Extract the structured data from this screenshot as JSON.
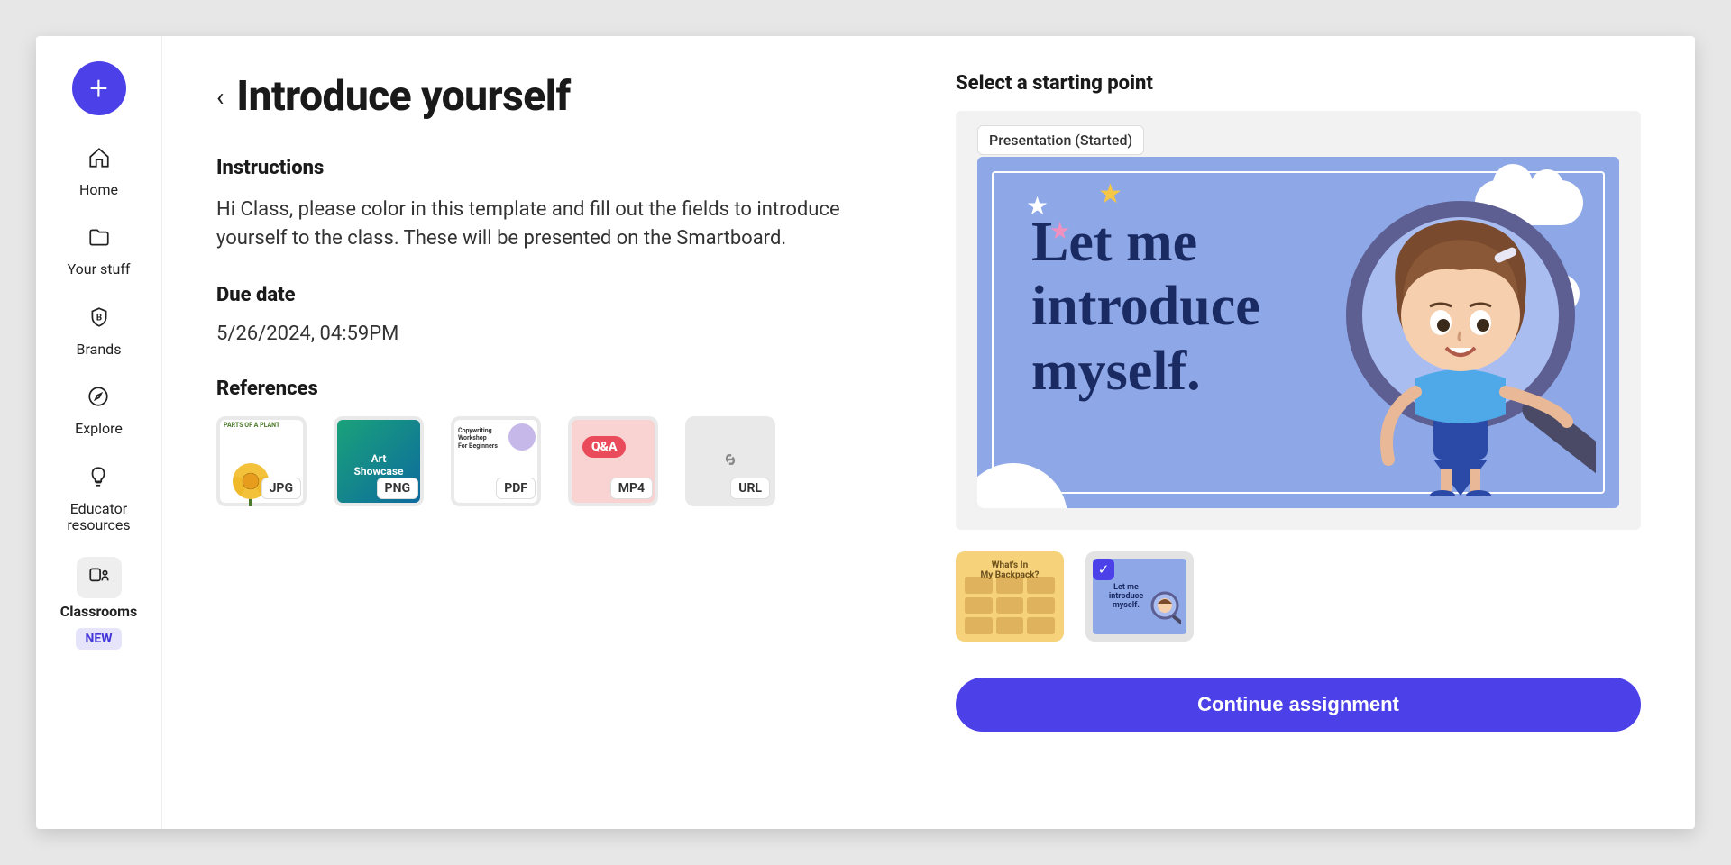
{
  "sidebar": {
    "items": [
      {
        "key": "home",
        "label": "Home"
      },
      {
        "key": "your-stuff",
        "label": "Your stuff"
      },
      {
        "key": "brands",
        "label": "Brands"
      },
      {
        "key": "explore",
        "label": "Explore"
      },
      {
        "key": "educator-resources",
        "label": "Educator\nresources"
      },
      {
        "key": "classrooms",
        "label": "Classrooms",
        "active": true,
        "badge": "NEW"
      }
    ]
  },
  "page": {
    "title": "Introduce yourself",
    "instructions_heading": "Instructions",
    "instructions_body": "Hi Class, please color in this template and fill out the fields to introduce yourself to the class. These will be presented on the Smartboard.",
    "duedate_heading": "Due date",
    "duedate_value": "5/26/2024, 04:59PM",
    "references_heading": "References",
    "references": [
      {
        "type": "JPG",
        "name": "parts-of-a-plant",
        "tiny": "PARTS OF A PLANT"
      },
      {
        "type": "PNG",
        "name": "art-showcase",
        "label": "Art\nShowcase"
      },
      {
        "type": "PDF",
        "name": "copywriting-workshop",
        "text": "Copywriting\nWorkshop\nFor Beginners"
      },
      {
        "type": "MP4",
        "name": "qa-video",
        "qa": "Q&A"
      },
      {
        "type": "URL",
        "name": "link"
      }
    ]
  },
  "starting_point": {
    "heading": "Select a starting point",
    "status": "Presentation (Started)",
    "preview_text": "Let me\nintroduce\nmyself.",
    "thumbs": [
      {
        "key": "backpack",
        "label": "What's In\nMy Backpack?",
        "selected": false
      },
      {
        "key": "introduce",
        "label": "Let me\nintroduce\nmyself.",
        "selected": true
      }
    ],
    "cta": "Continue assignment"
  }
}
